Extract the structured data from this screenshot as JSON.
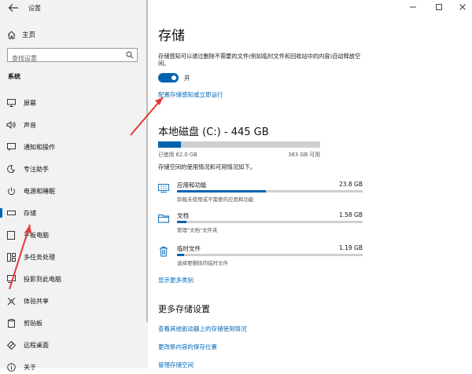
{
  "window": {
    "title": "设置"
  },
  "sidebar": {
    "home_label": "主页",
    "search_placeholder": "查找设置",
    "section_label": "系统",
    "items": [
      {
        "label": "屏幕",
        "icon": "monitor-icon"
      },
      {
        "label": "声音",
        "icon": "speaker-icon"
      },
      {
        "label": "通知和操作",
        "icon": "notification-icon"
      },
      {
        "label": "专注助手",
        "icon": "moon-icon"
      },
      {
        "label": "电源和睡眠",
        "icon": "power-icon"
      },
      {
        "label": "存储",
        "icon": "storage-icon",
        "active": true
      },
      {
        "label": "平板电脑",
        "icon": "tablet-icon"
      },
      {
        "label": "多任务处理",
        "icon": "multitask-icon"
      },
      {
        "label": "投影到此电脑",
        "icon": "project-icon"
      },
      {
        "label": "体验共享",
        "icon": "share-icon"
      },
      {
        "label": "剪贴板",
        "icon": "clipboard-icon"
      },
      {
        "label": "远程桌面",
        "icon": "remote-desktop-icon"
      },
      {
        "label": "关于",
        "icon": "info-icon"
      }
    ]
  },
  "main": {
    "title": "存储",
    "description": "存储感知可以通过删除不需要的文件(例如临时文件和回收站中的内容)自动释放空间。",
    "toggle": {
      "state_label": "开",
      "on": true
    },
    "config_link": "配置存储感知或立即运行",
    "disk": {
      "title": "本地磁盘 (C:) - 445 GB",
      "used_label": "已使用 62.0 GB",
      "free_label": "383 GB 可用",
      "used_fraction": 0.14
    },
    "usage_intro": "存储空间的使用情况和可用情况如下。",
    "categories": [
      {
        "name": "应用和功能",
        "size": "23.8 GB",
        "sub": "卸载未使用或不需要的应用和功能",
        "fraction": 0.48,
        "icon": "apps-icon"
      },
      {
        "name": "文档",
        "size": "1.58 GB",
        "sub": "管理\"文档\"文件夹",
        "fraction": 0.05,
        "icon": "folder-icon"
      },
      {
        "name": "临时文件",
        "size": "1.19 GB",
        "sub": "选择要删除的临时文件",
        "fraction": 0.04,
        "icon": "trash-icon"
      }
    ],
    "show_more": "显示更多类别",
    "more_settings": {
      "title": "更多存储设置",
      "links": [
        "查看其他驱动器上的存储使用情况",
        "更改新内容的保存位置",
        "管理存储空间"
      ]
    }
  },
  "colors": {
    "accent": "#0063b1",
    "link": "#0067b8",
    "annotation_arrow": "#e53935"
  }
}
